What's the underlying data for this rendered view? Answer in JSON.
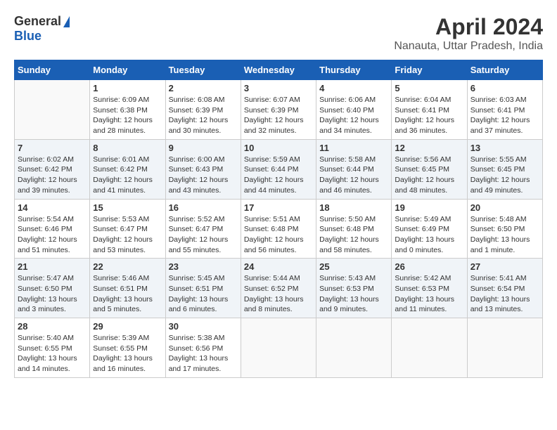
{
  "header": {
    "logo_general": "General",
    "logo_blue": "Blue",
    "title": "April 2024",
    "subtitle": "Nanauta, Uttar Pradesh, India"
  },
  "calendar": {
    "columns": [
      "Sunday",
      "Monday",
      "Tuesday",
      "Wednesday",
      "Thursday",
      "Friday",
      "Saturday"
    ],
    "rows": [
      [
        {
          "day": "",
          "info": ""
        },
        {
          "day": "1",
          "info": "Sunrise: 6:09 AM\nSunset: 6:38 PM\nDaylight: 12 hours\nand 28 minutes."
        },
        {
          "day": "2",
          "info": "Sunrise: 6:08 AM\nSunset: 6:39 PM\nDaylight: 12 hours\nand 30 minutes."
        },
        {
          "day": "3",
          "info": "Sunrise: 6:07 AM\nSunset: 6:39 PM\nDaylight: 12 hours\nand 32 minutes."
        },
        {
          "day": "4",
          "info": "Sunrise: 6:06 AM\nSunset: 6:40 PM\nDaylight: 12 hours\nand 34 minutes."
        },
        {
          "day": "5",
          "info": "Sunrise: 6:04 AM\nSunset: 6:41 PM\nDaylight: 12 hours\nand 36 minutes."
        },
        {
          "day": "6",
          "info": "Sunrise: 6:03 AM\nSunset: 6:41 PM\nDaylight: 12 hours\nand 37 minutes."
        }
      ],
      [
        {
          "day": "7",
          "info": "Sunrise: 6:02 AM\nSunset: 6:42 PM\nDaylight: 12 hours\nand 39 minutes."
        },
        {
          "day": "8",
          "info": "Sunrise: 6:01 AM\nSunset: 6:42 PM\nDaylight: 12 hours\nand 41 minutes."
        },
        {
          "day": "9",
          "info": "Sunrise: 6:00 AM\nSunset: 6:43 PM\nDaylight: 12 hours\nand 43 minutes."
        },
        {
          "day": "10",
          "info": "Sunrise: 5:59 AM\nSunset: 6:44 PM\nDaylight: 12 hours\nand 44 minutes."
        },
        {
          "day": "11",
          "info": "Sunrise: 5:58 AM\nSunset: 6:44 PM\nDaylight: 12 hours\nand 46 minutes."
        },
        {
          "day": "12",
          "info": "Sunrise: 5:56 AM\nSunset: 6:45 PM\nDaylight: 12 hours\nand 48 minutes."
        },
        {
          "day": "13",
          "info": "Sunrise: 5:55 AM\nSunset: 6:45 PM\nDaylight: 12 hours\nand 49 minutes."
        }
      ],
      [
        {
          "day": "14",
          "info": "Sunrise: 5:54 AM\nSunset: 6:46 PM\nDaylight: 12 hours\nand 51 minutes."
        },
        {
          "day": "15",
          "info": "Sunrise: 5:53 AM\nSunset: 6:47 PM\nDaylight: 12 hours\nand 53 minutes."
        },
        {
          "day": "16",
          "info": "Sunrise: 5:52 AM\nSunset: 6:47 PM\nDaylight: 12 hours\nand 55 minutes."
        },
        {
          "day": "17",
          "info": "Sunrise: 5:51 AM\nSunset: 6:48 PM\nDaylight: 12 hours\nand 56 minutes."
        },
        {
          "day": "18",
          "info": "Sunrise: 5:50 AM\nSunset: 6:48 PM\nDaylight: 12 hours\nand 58 minutes."
        },
        {
          "day": "19",
          "info": "Sunrise: 5:49 AM\nSunset: 6:49 PM\nDaylight: 13 hours\nand 0 minutes."
        },
        {
          "day": "20",
          "info": "Sunrise: 5:48 AM\nSunset: 6:50 PM\nDaylight: 13 hours\nand 1 minute."
        }
      ],
      [
        {
          "day": "21",
          "info": "Sunrise: 5:47 AM\nSunset: 6:50 PM\nDaylight: 13 hours\nand 3 minutes."
        },
        {
          "day": "22",
          "info": "Sunrise: 5:46 AM\nSunset: 6:51 PM\nDaylight: 13 hours\nand 5 minutes."
        },
        {
          "day": "23",
          "info": "Sunrise: 5:45 AM\nSunset: 6:51 PM\nDaylight: 13 hours\nand 6 minutes."
        },
        {
          "day": "24",
          "info": "Sunrise: 5:44 AM\nSunset: 6:52 PM\nDaylight: 13 hours\nand 8 minutes."
        },
        {
          "day": "25",
          "info": "Sunrise: 5:43 AM\nSunset: 6:53 PM\nDaylight: 13 hours\nand 9 minutes."
        },
        {
          "day": "26",
          "info": "Sunrise: 5:42 AM\nSunset: 6:53 PM\nDaylight: 13 hours\nand 11 minutes."
        },
        {
          "day": "27",
          "info": "Sunrise: 5:41 AM\nSunset: 6:54 PM\nDaylight: 13 hours\nand 13 minutes."
        }
      ],
      [
        {
          "day": "28",
          "info": "Sunrise: 5:40 AM\nSunset: 6:55 PM\nDaylight: 13 hours\nand 14 minutes."
        },
        {
          "day": "29",
          "info": "Sunrise: 5:39 AM\nSunset: 6:55 PM\nDaylight: 13 hours\nand 16 minutes."
        },
        {
          "day": "30",
          "info": "Sunrise: 5:38 AM\nSunset: 6:56 PM\nDaylight: 13 hours\nand 17 minutes."
        },
        {
          "day": "",
          "info": ""
        },
        {
          "day": "",
          "info": ""
        },
        {
          "day": "",
          "info": ""
        },
        {
          "day": "",
          "info": ""
        }
      ]
    ],
    "row_classes": [
      "row-white",
      "row-shaded",
      "row-white",
      "row-shaded",
      "row-white"
    ]
  }
}
